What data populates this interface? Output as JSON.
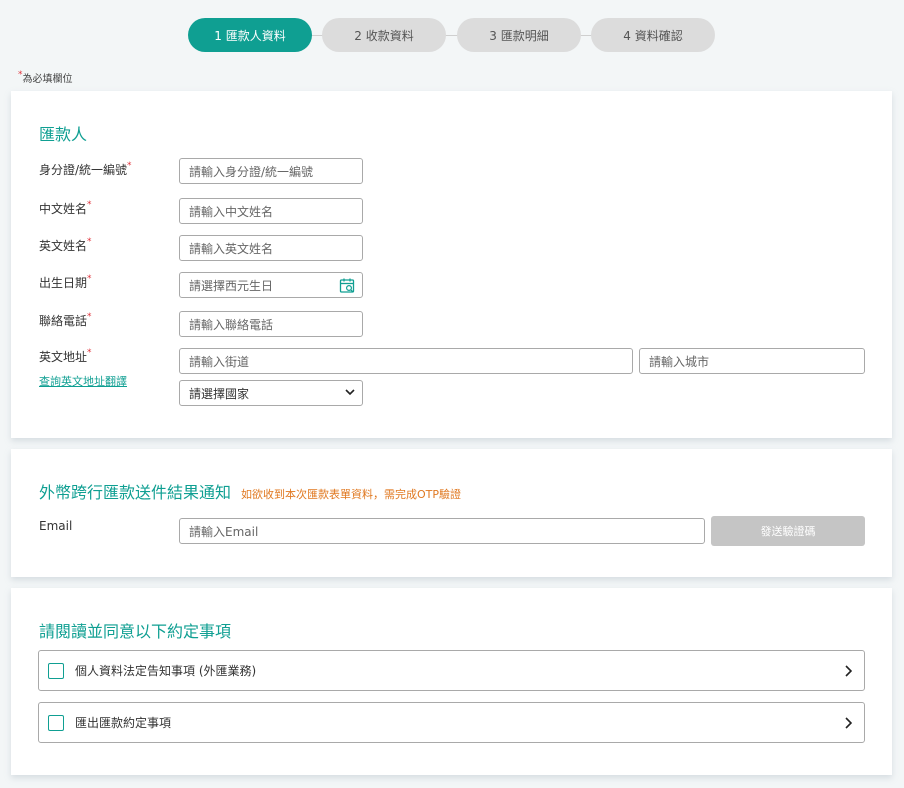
{
  "steps": [
    {
      "label": "1 匯款人資料",
      "active": true
    },
    {
      "label": "2 收款資料",
      "active": false
    },
    {
      "label": "3 匯款明細",
      "active": false
    },
    {
      "label": "4 資料確認",
      "active": false
    }
  ],
  "required_note": "為必填欄位",
  "remitter": {
    "title": "匯款人",
    "id_label": "身分證/統一編號",
    "id_placeholder": "請輸入身分證/統一編號",
    "cn_name_label": "中文姓名",
    "cn_name_placeholder": "請輸入中文姓名",
    "en_name_label": "英文姓名",
    "en_name_placeholder": "請輸入英文姓名",
    "birth_label": "出生日期",
    "birth_placeholder": "請選擇西元生日",
    "phone_label": "聯絡電話",
    "phone_placeholder": "請輸入聯絡電話",
    "address_label": "英文地址",
    "address_link": "查詢英文地址翻譯",
    "street_placeholder": "請輸入街道",
    "city_placeholder": "請輸入城市",
    "country_placeholder": "請選擇國家"
  },
  "notify": {
    "title": "外幣跨行匯款送件結果通知",
    "hint": "如欲收到本次匯款表單資料，需完成OTP驗證",
    "email_label": "Email",
    "email_placeholder": "請輸入Email",
    "send_button": "發送驗證碼"
  },
  "agreement": {
    "title": "請閱讀並同意以下約定事項",
    "items": [
      {
        "label": "個人資料法定告知事項 (外匯業務)"
      },
      {
        "label": "匯出匯款約定事項"
      }
    ]
  },
  "colors": {
    "accent": "#0f9f92",
    "required": "#e0343c",
    "hint": "#e07820",
    "disabled": "#c5c5c5"
  }
}
